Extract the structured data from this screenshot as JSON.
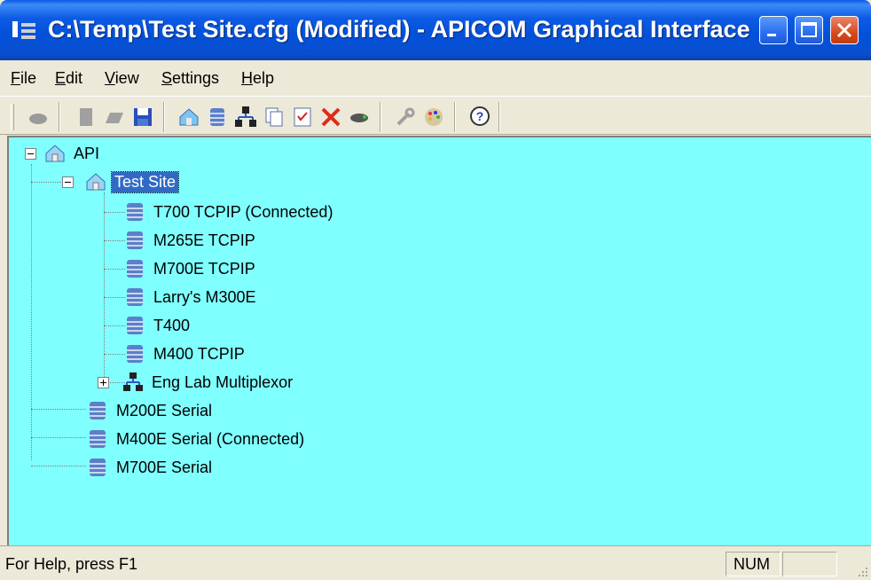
{
  "window": {
    "title": "C:\\Temp\\Test Site.cfg (Modified) - APICOM Graphical Interface",
    "icon": "app-icon"
  },
  "menu": [
    {
      "label": "File",
      "underline": "F",
      "rest": "ile"
    },
    {
      "label": "Edit",
      "underline": "E",
      "rest": "dit"
    },
    {
      "label": "View",
      "underline": "V",
      "rest": "iew"
    },
    {
      "label": "Settings",
      "underline": "S",
      "rest": "ettings"
    },
    {
      "label": "Help",
      "underline": "H",
      "rest": "elp"
    }
  ],
  "toolbar": {
    "icons": [
      "connect-icon",
      "new-icon",
      "open-icon",
      "save-icon",
      "add-site-icon",
      "add-instrument-icon",
      "add-multiplexor-icon",
      "copy-icon",
      "properties-icon",
      "delete-icon",
      "disconnect-icon",
      "settings-icon",
      "colors-icon",
      "help-icon"
    ]
  },
  "tree": {
    "root": {
      "label": "API"
    },
    "site": {
      "label": "Test Site"
    },
    "site_children": [
      {
        "label": "T700 TCPIP (Connected)"
      },
      {
        "label": "M265E TCPIP"
      },
      {
        "label": "M700E TCPIP"
      },
      {
        "label": "Larry's  M300E"
      },
      {
        "label": "T400"
      },
      {
        "label": "M400 TCPIP"
      }
    ],
    "multiplexor": {
      "label": "Eng Lab Multiplexor"
    },
    "root_children": [
      {
        "label": "M200E Serial"
      },
      {
        "label": "M400E Serial (Connected)"
      },
      {
        "label": "M700E Serial"
      }
    ]
  },
  "status": {
    "text": "For Help, press F1",
    "num": "NUM"
  },
  "colors": {
    "tree_background": "#80ffff",
    "selection": "#316ac5",
    "titlebar": "#0350d8"
  }
}
